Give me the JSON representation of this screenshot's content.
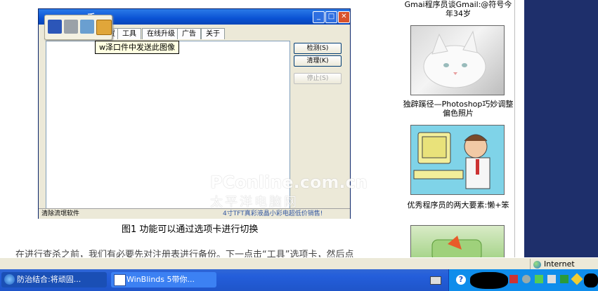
{
  "dialog": {
    "title": "▪▪▪▪▪▪手",
    "tabs": [
      "▪▪▪▪▪",
      "设置",
      "工具",
      "在线升级",
      "广告",
      "关于"
    ],
    "tooltip": "w泽口件中发送此图像",
    "buttons": {
      "detect": "检测(S)",
      "clean": "清理(K)",
      "stop": "停止(S)"
    },
    "status_left": "清除流氓软件",
    "status_right": "4寸TFT真彩液晶小彩电超低价销售!",
    "watermark_brand": "PConline.com.cn",
    "watermark_cn": "太平洋电脑网"
  },
  "article": {
    "caption": "图1 功能可以通过选项卡进行切换",
    "body_partial": "在进行查杀之前，我们有必要先对注册表进行备份。下一点击“工具”选项卡，然后点"
  },
  "sidebar": {
    "items": [
      {
        "title": "Gmai程序员谈Gmail:@符号今年34岁"
      },
      {
        "title": "独辟蹊径—Photoshop巧妙调整偏色照片"
      },
      {
        "title": "优秀程序员的两大要素:懒+笨"
      }
    ]
  },
  "ie_status": {
    "zone": "Internet"
  },
  "taskbar": {
    "tasks": [
      {
        "label": "防治结合:将顽固..."
      },
      {
        "label": "WinBlinds 5带你..."
      }
    ]
  },
  "colors": {
    "taskbar": "#245edb",
    "tray": "#0f8deb",
    "right_panel": "#1e2f6b"
  }
}
